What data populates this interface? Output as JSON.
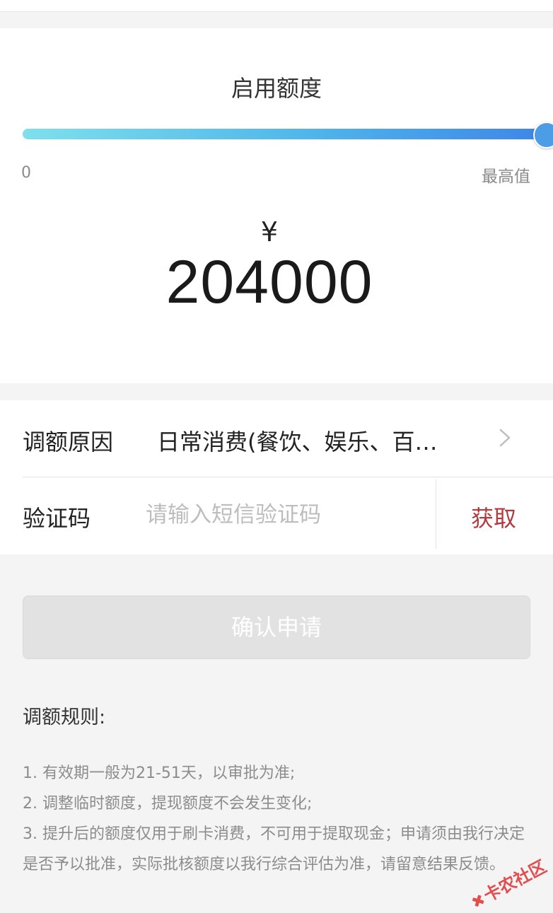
{
  "limit": {
    "title": "启用额度",
    "slider_min_label": "0",
    "slider_max_label": "最高值",
    "slider_fraction": 1.0,
    "currency_symbol": "¥",
    "amount": "204000"
  },
  "form": {
    "reason_label": "调额原因",
    "reason_value": "日常消费(餐饮、娱乐、百…",
    "code_label": "验证码",
    "code_placeholder": "请输入短信验证码",
    "code_value": "",
    "get_code_label": "获取"
  },
  "confirm_button_label": "确认申请",
  "rules": {
    "title": "调额规则:",
    "items": [
      "1. 有效期一般为21-51天，以审批为准;",
      "2. 调整临时额度，提现额度不会发生变化;",
      "3. 提升后的额度仅用于刷卡消费，不可用于提取现金；申请须由我行决定是否予以批准，实际批核额度以我行综合评估为准，请留意结果反馈。"
    ]
  },
  "watermark_text": "卡农社区",
  "colors": {
    "get_code": "#b23a3e",
    "slider_start": "#7ee0ec",
    "slider_end": "#3f86e8",
    "button_disabled": "#e2e2e2"
  }
}
